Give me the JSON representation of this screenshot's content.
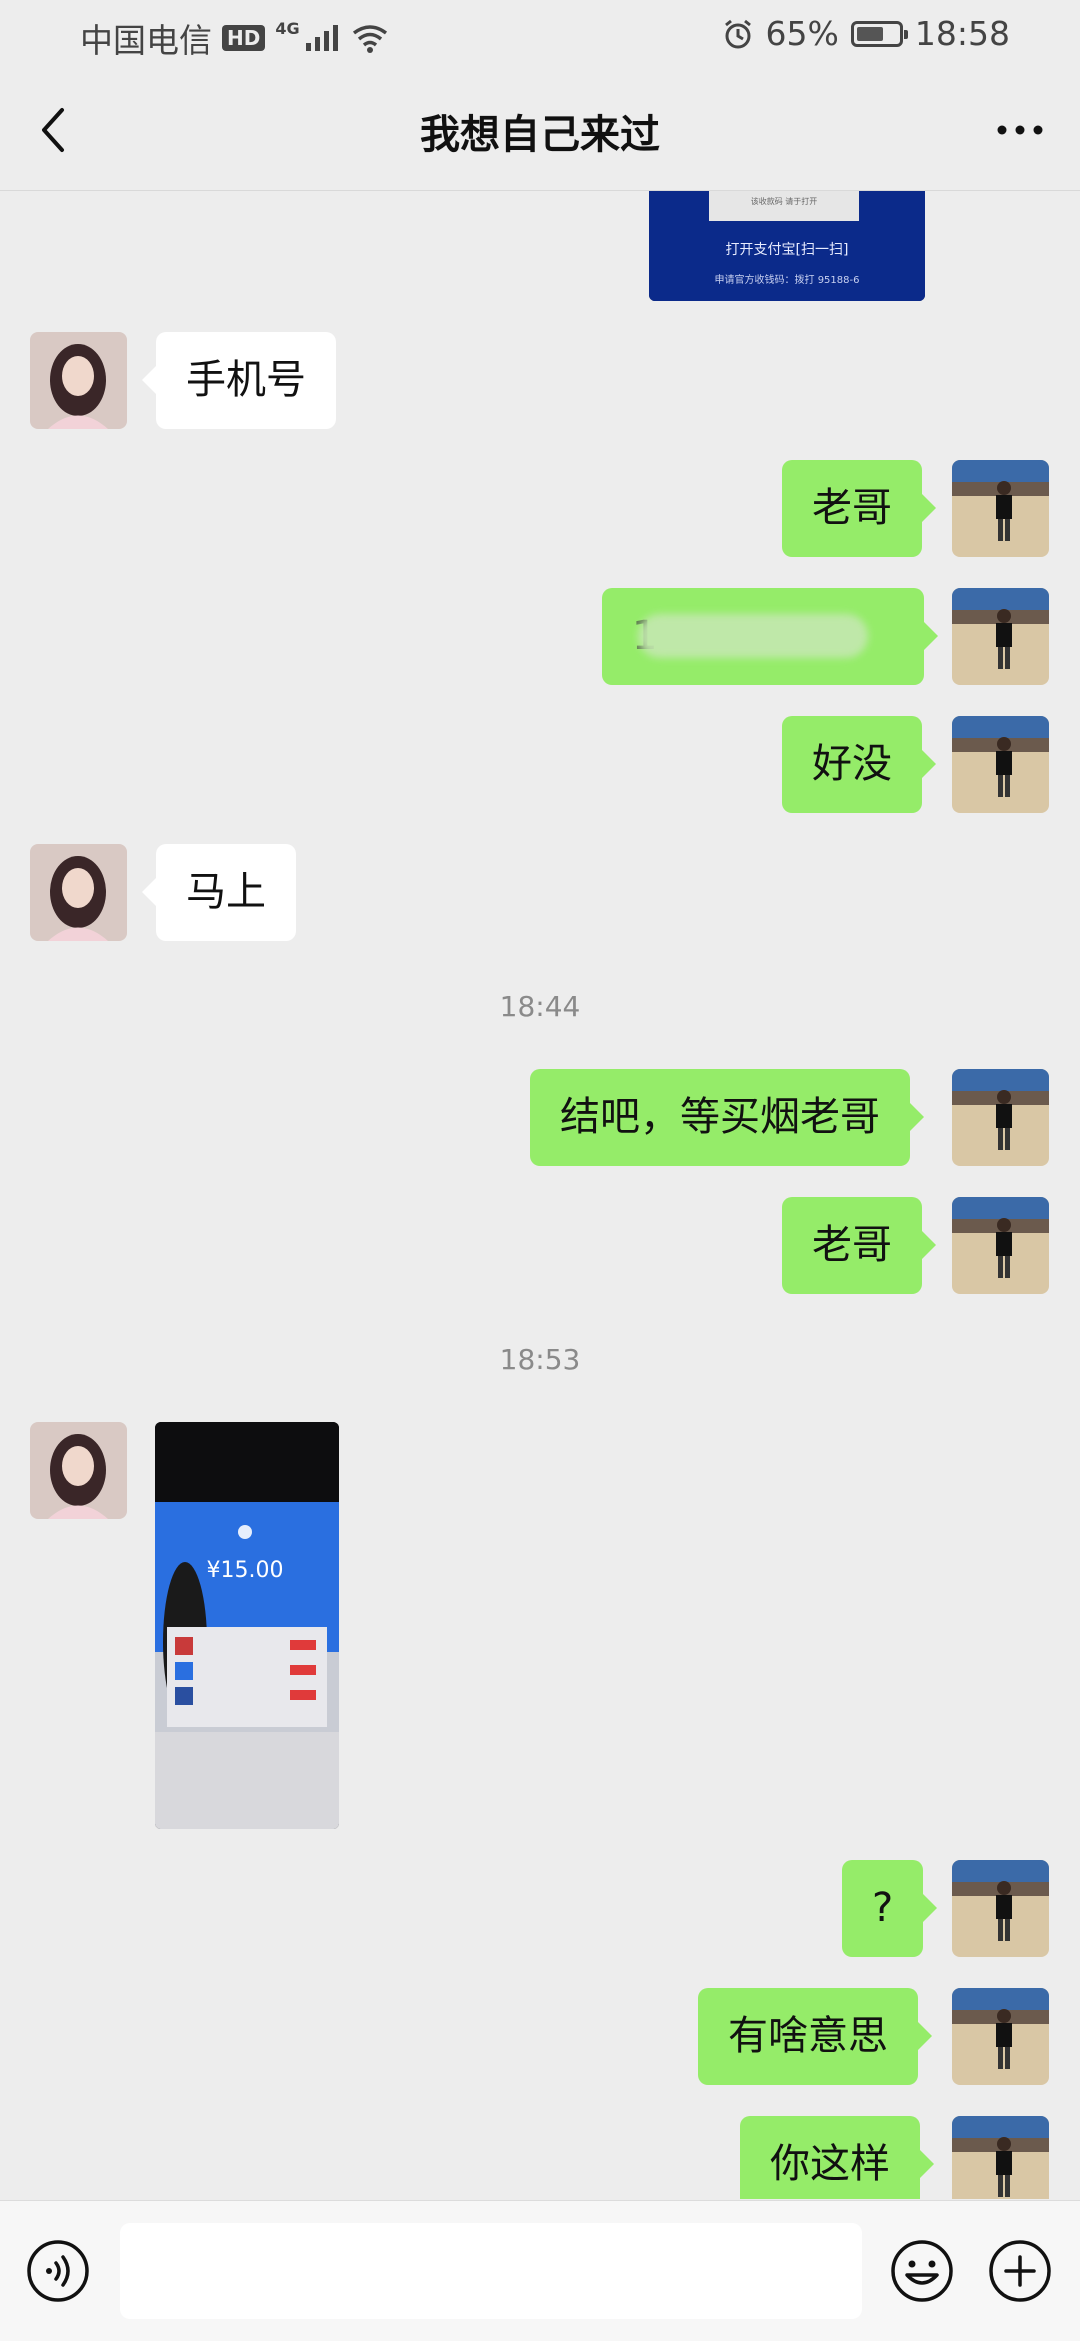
{
  "status_bar": {
    "carrier": "中国电信",
    "hd": "HD",
    "network": "4G",
    "battery_percent": "65%",
    "battery_level": 0.65,
    "time": "18:58"
  },
  "header": {
    "title": "我想自己来过"
  },
  "messages": {
    "top_image_caption_scan": "打开支付宝[扫一扫]",
    "top_image_caption_small": "申请官方收钱码：拨打 95188-6",
    "top_image_caption_tiny": "该收款码 请于打开",
    "m1": "手机号",
    "m2": "老哥",
    "m3_visible": "1",
    "m4": "好没",
    "m5": "马上",
    "ts1": "18:44",
    "m6": "结吧，等买烟老哥",
    "m7": "老哥",
    "ts2": "18:53",
    "m8_amount": "¥15.00",
    "m9": "?",
    "m10": "有啥意思",
    "m11": "你这样"
  },
  "colors": {
    "bg": "#ededed",
    "incoming": "#ffffff",
    "outgoing": "#95ec69"
  },
  "icons": [
    "back-icon",
    "more-icon",
    "voice-icon",
    "emoji-icon",
    "plus-icon"
  ]
}
